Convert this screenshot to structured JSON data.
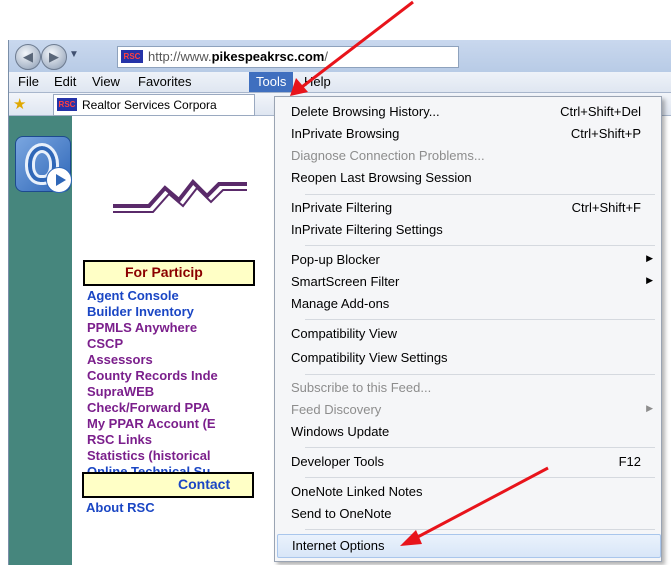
{
  "browser": {
    "url_prefix": "http://www.",
    "url_domain": "pikespeakrsc.com",
    "url_suffix": "/",
    "favicon_text": "RSC",
    "menu": [
      "File",
      "Edit",
      "View",
      "Favorites",
      "Tools",
      "Help"
    ],
    "active_menu": "Tools",
    "favorites_tab": "Realtor Services Corpora"
  },
  "page": {
    "participants_header": "For Particip",
    "links": [
      "Agent Console",
      "Builder Inventory",
      "PPMLS Anywhere",
      "CSCP",
      "Assessors",
      "County Records Inde",
      "SupraWEB",
      "Check/Forward PPA",
      "My PPAR Account (E",
      "RSC Links",
      "Statistics (historical",
      "Online Technical Su"
    ],
    "contact_header": "Contact",
    "links2": [
      "About RSC"
    ]
  },
  "tools_menu": {
    "items": [
      {
        "label": "Delete Browsing History...",
        "shortcut": "Ctrl+Shift+Del"
      },
      {
        "label": "InPrivate Browsing",
        "shortcut": "Ctrl+Shift+P"
      },
      {
        "label": "Diagnose Connection Problems...",
        "disabled": true
      },
      {
        "label": "Reopen Last Browsing Session"
      },
      {
        "label": "InPrivate Filtering",
        "shortcut": "Ctrl+Shift+F"
      },
      {
        "label": "InPrivate Filtering Settings"
      },
      {
        "label": "Pop-up Blocker",
        "submenu": true
      },
      {
        "label": "SmartScreen Filter",
        "submenu": true
      },
      {
        "label": "Manage Add-ons"
      },
      {
        "label": "Compatibility View"
      },
      {
        "label": "Compatibility View Settings"
      },
      {
        "label": "Subscribe to this Feed...",
        "disabled": true
      },
      {
        "label": "Feed Discovery",
        "disabled": true,
        "submenu": true
      },
      {
        "label": "Windows Update"
      },
      {
        "label": "Developer Tools",
        "shortcut": "F12"
      },
      {
        "label": "OneNote Linked Notes"
      },
      {
        "label": "Send to OneNote"
      },
      {
        "label": "Internet Options",
        "highlighted": true
      }
    ]
  },
  "colors": {
    "accent": "#3f6fbf",
    "annotation_arrow": "#e8141b",
    "sidebar": "#46867d"
  }
}
